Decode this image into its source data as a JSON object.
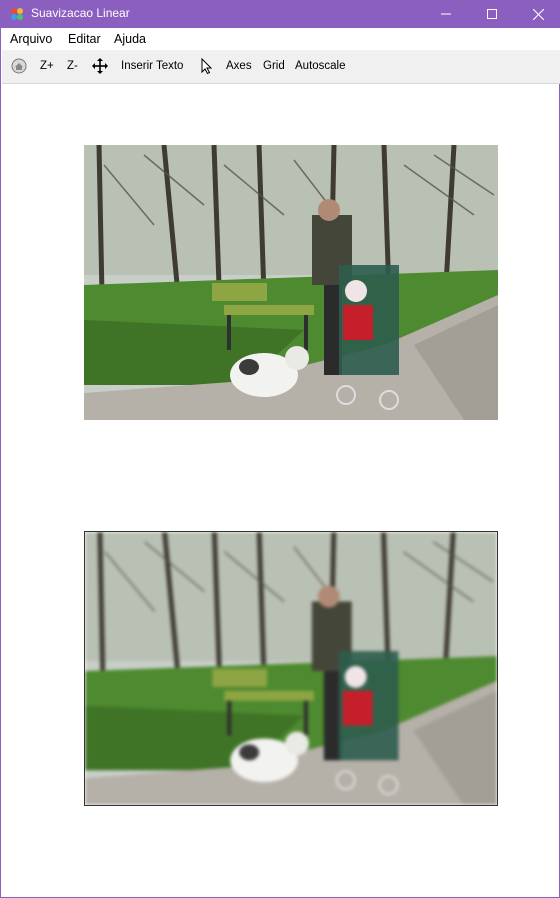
{
  "window": {
    "title": "Suavizacao Linear",
    "accent_color": "#8a5fbf"
  },
  "menu": {
    "items": [
      "Arquivo",
      "Editar",
      "Ajuda"
    ]
  },
  "toolbar": {
    "home_icon": "home-icon",
    "zoom_in_label": "Z+",
    "zoom_out_label": "Z-",
    "pan_icon": "move-arrows-icon",
    "insert_text_label": "Inserir Texto",
    "pointer_icon": "pointer-icon",
    "axes_label": "Axes",
    "grid_label": "Grid",
    "autoscale_label": "Autoscale"
  },
  "images": [
    {
      "name": "original-image",
      "content": "park scene: man with stroller, child and dog"
    },
    {
      "name": "smoothed-image",
      "content": "park scene: man with stroller, child and dog (blurred)"
    }
  ]
}
